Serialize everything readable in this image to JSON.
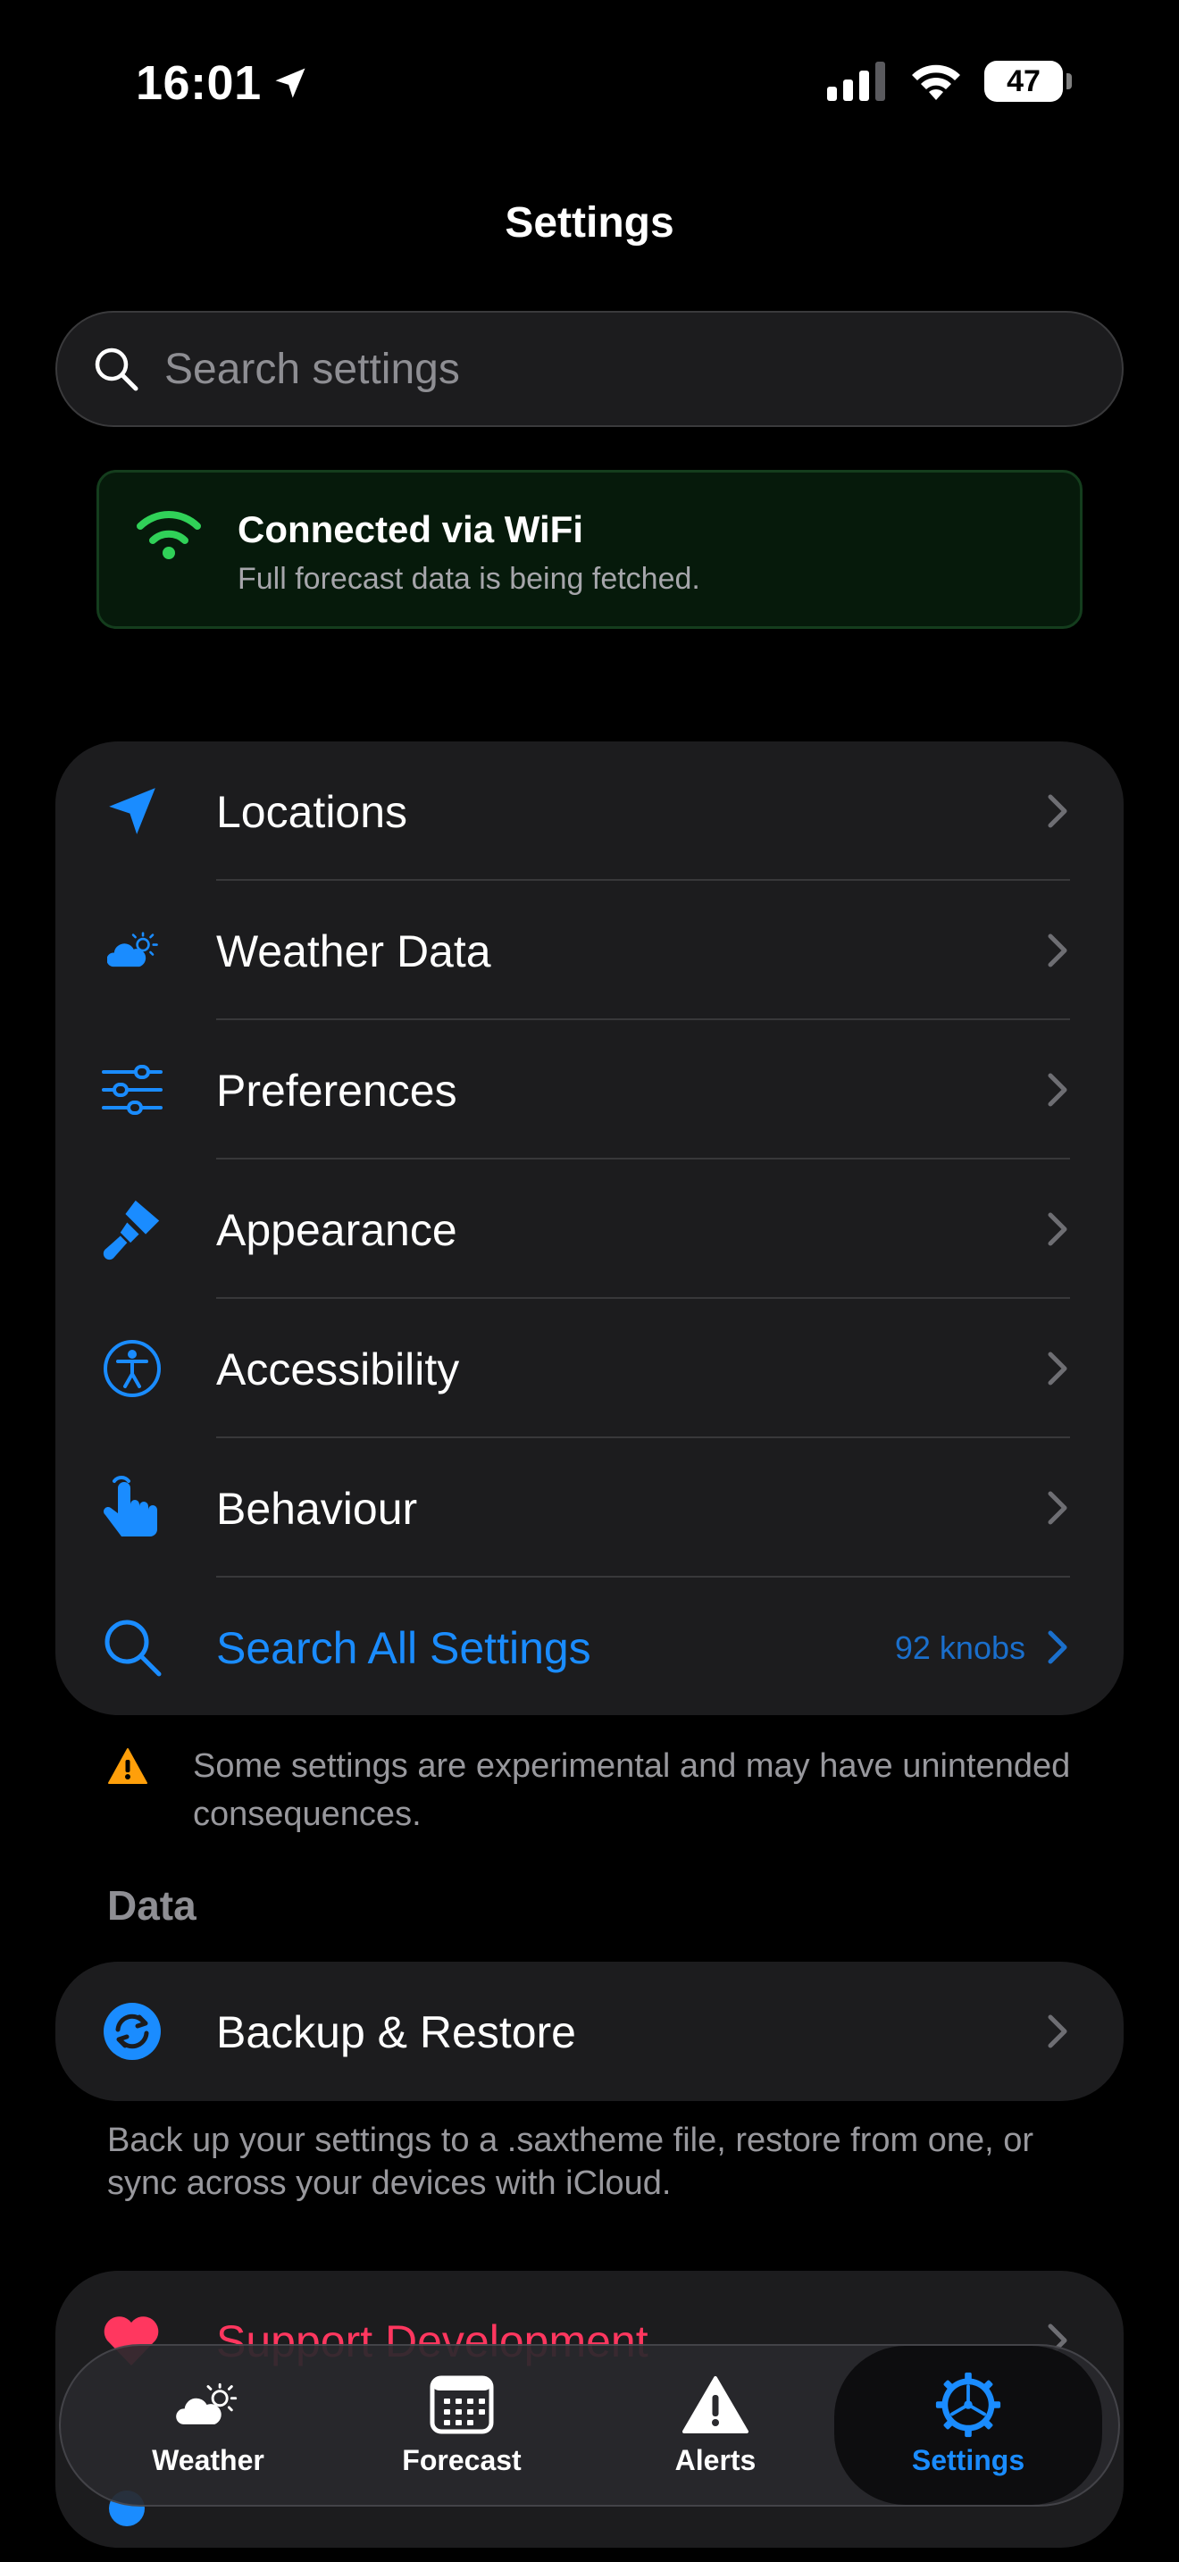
{
  "status": {
    "time": "16:01",
    "battery": "47"
  },
  "title": "Settings",
  "search": {
    "placeholder": "Search settings"
  },
  "wifi_banner": {
    "title": "Connected via WiFi",
    "subtitle": "Full forecast data is being fetched."
  },
  "menu": {
    "items": [
      {
        "label": "Locations",
        "icon": "location-arrow-icon"
      },
      {
        "label": "Weather Data",
        "icon": "cloud-sun-icon"
      },
      {
        "label": "Preferences",
        "icon": "sliders-icon"
      },
      {
        "label": "Appearance",
        "icon": "paintbrush-icon"
      },
      {
        "label": "Accessibility",
        "icon": "accessibility-icon"
      },
      {
        "label": "Behaviour",
        "icon": "hand-tap-icon"
      }
    ],
    "search_all": {
      "label": "Search All Settings",
      "meta": "92 knobs"
    }
  },
  "warning": "Some settings are experimental and may have unintended consequences.",
  "data_section": {
    "header": "Data",
    "backup_label": "Backup & Restore",
    "footnote": "Back up your settings to a .saxtheme file, restore from one, or sync across your devices with iCloud."
  },
  "support": {
    "label": "Support Development"
  },
  "tabs": [
    {
      "label": "Weather",
      "icon": "weather-icon"
    },
    {
      "label": "Forecast",
      "icon": "calendar-icon"
    },
    {
      "label": "Alerts",
      "icon": "alert-icon"
    },
    {
      "label": "Settings",
      "icon": "settings-gear-icon",
      "active": true
    }
  ],
  "colors": {
    "accent": "#1a8cff",
    "background": "#000000",
    "card": "#1c1c1e",
    "wifi_green": "#30d158",
    "warning_orange": "#ff9f0a",
    "support_red": "#ff375f"
  }
}
